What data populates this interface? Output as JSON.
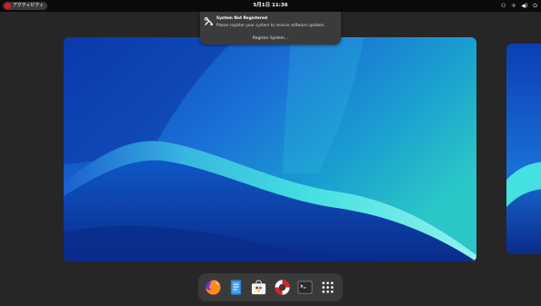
{
  "topbar": {
    "activities_label": "アクティビティ",
    "clock": "5月1日 11:36",
    "tray_icons": [
      "accessibility-icon",
      "network-icon",
      "volume-icon",
      "power-icon"
    ]
  },
  "notification": {
    "icon": "system-settings-icon",
    "title": "System Not Registered",
    "body": "Please register your system to receive software updates.",
    "action_label": "Register System..."
  },
  "dock": {
    "apps": [
      {
        "name": "firefox-icon"
      },
      {
        "name": "text-editor-icon"
      },
      {
        "name": "software-store-icon"
      },
      {
        "name": "help-lifebuoy-icon"
      },
      {
        "name": "terminal-icon"
      },
      {
        "name": "show-apps-grid-icon"
      }
    ]
  },
  "colors": {
    "topbar_bg": "#0b0b0b",
    "workspace_bg": "#262626",
    "notification_bg": "#3b3b3b",
    "dock_bg": "#3a3a3a",
    "logo_red": "#e01b24"
  }
}
